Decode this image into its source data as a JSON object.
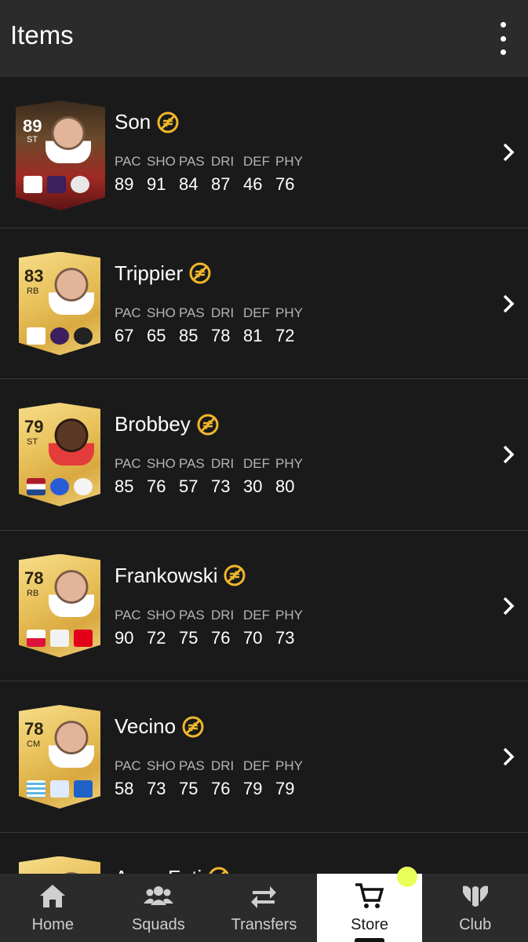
{
  "header": {
    "title": "Items"
  },
  "stat_labels": [
    "PAC",
    "SHO",
    "PAS",
    "DRI",
    "DEF",
    "PHY"
  ],
  "players": [
    {
      "name": "Son",
      "rating": "89",
      "position": "ST",
      "stats": [
        "89",
        "91",
        "84",
        "87",
        "46",
        "76"
      ]
    },
    {
      "name": "Trippier",
      "rating": "83",
      "position": "RB",
      "stats": [
        "67",
        "65",
        "85",
        "78",
        "81",
        "72"
      ]
    },
    {
      "name": "Brobbey",
      "rating": "79",
      "position": "ST",
      "stats": [
        "85",
        "76",
        "57",
        "73",
        "30",
        "80"
      ]
    },
    {
      "name": "Frankowski",
      "rating": "78",
      "position": "RB",
      "stats": [
        "90",
        "72",
        "75",
        "76",
        "70",
        "73"
      ]
    },
    {
      "name": "Vecino",
      "rating": "78",
      "position": "CM",
      "stats": [
        "58",
        "73",
        "75",
        "76",
        "79",
        "79"
      ]
    },
    {
      "name": "Anou Fati",
      "rating": "",
      "position": "",
      "stats": [
        "",
        "",
        "",
        "",
        "",
        ""
      ]
    }
  ],
  "nav": {
    "items": [
      {
        "label": "Home",
        "icon": "home-icon"
      },
      {
        "label": "Squads",
        "icon": "squads-icon"
      },
      {
        "label": "Transfers",
        "icon": "transfers-icon"
      },
      {
        "label": "Store",
        "icon": "cart-icon"
      },
      {
        "label": "Club",
        "icon": "club-icon"
      }
    ]
  },
  "colors": {
    "accent": "#f0b72a",
    "background": "#1a1a1a",
    "header": "#2b2b2b",
    "notification": "#e9ff5a"
  }
}
